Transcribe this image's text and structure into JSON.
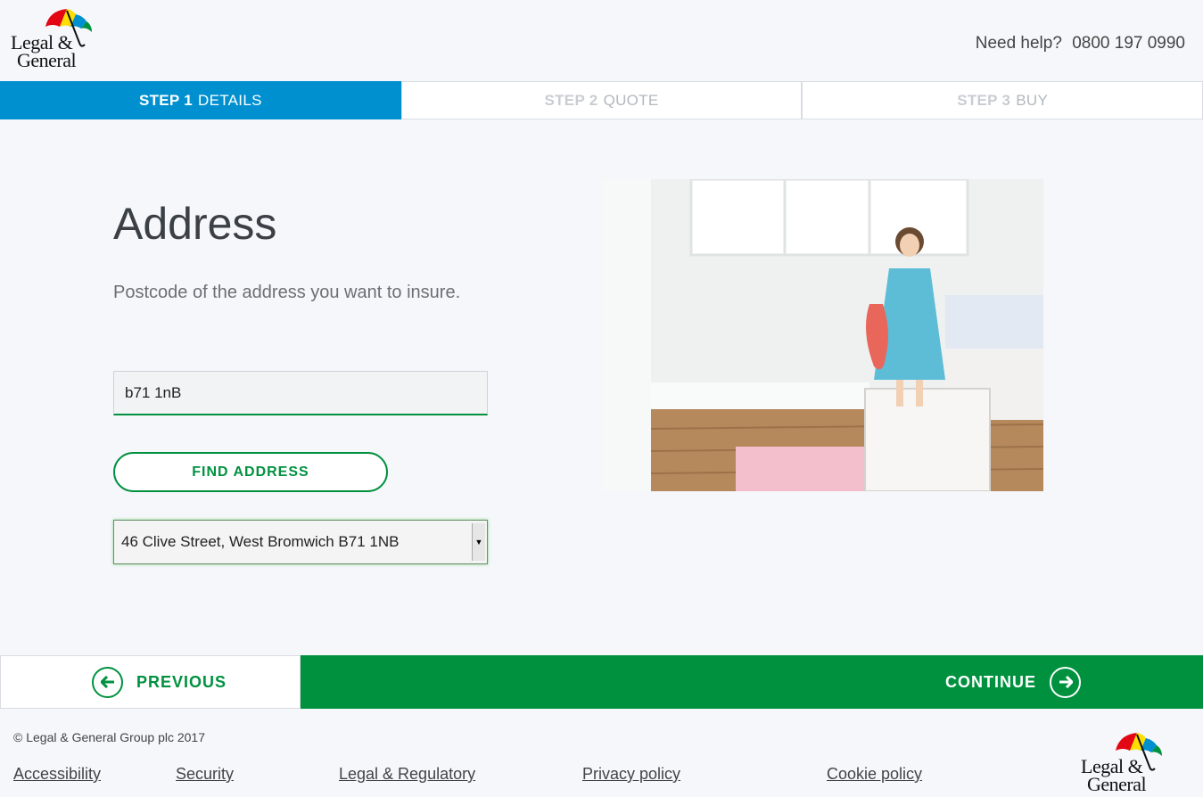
{
  "brand": {
    "logo_line1": "Legal &",
    "logo_line2": "General",
    "umbrella_colors": [
      "#e30613",
      "#ffde00",
      "#0090d0",
      "#00913f"
    ]
  },
  "header": {
    "help_label": "Need help?",
    "phone": "0800 197 0990"
  },
  "steps": [
    {
      "number": "STEP 1",
      "label": "DETAILS",
      "active": true
    },
    {
      "number": "STEP 2",
      "label": "QUOTE",
      "active": false
    },
    {
      "number": "STEP 3",
      "label": "BUY",
      "active": false
    }
  ],
  "form": {
    "title": "Address",
    "subtitle": "Postcode of the address you want to insure.",
    "postcode_value": "b71 1nB",
    "find_button": "FIND ADDRESS",
    "selected_address": "46 Clive Street, West Bromwich B71 1NB"
  },
  "navigation": {
    "previous": "PREVIOUS",
    "continue": "CONTINUE"
  },
  "footer": {
    "copyright": "© Legal & General Group plc 2017",
    "links": [
      "Accessibility",
      "Security",
      "Legal & Regulatory",
      "Privacy policy",
      "Cookie policy"
    ]
  },
  "colors": {
    "accent_blue": "#0090d0",
    "brand_green": "#00913f",
    "background": "#f5f7fa"
  },
  "icons": {
    "previous": "arrow-left-circle-icon",
    "continue": "arrow-right-circle-icon",
    "select": "dropdown-arrow-icon"
  }
}
